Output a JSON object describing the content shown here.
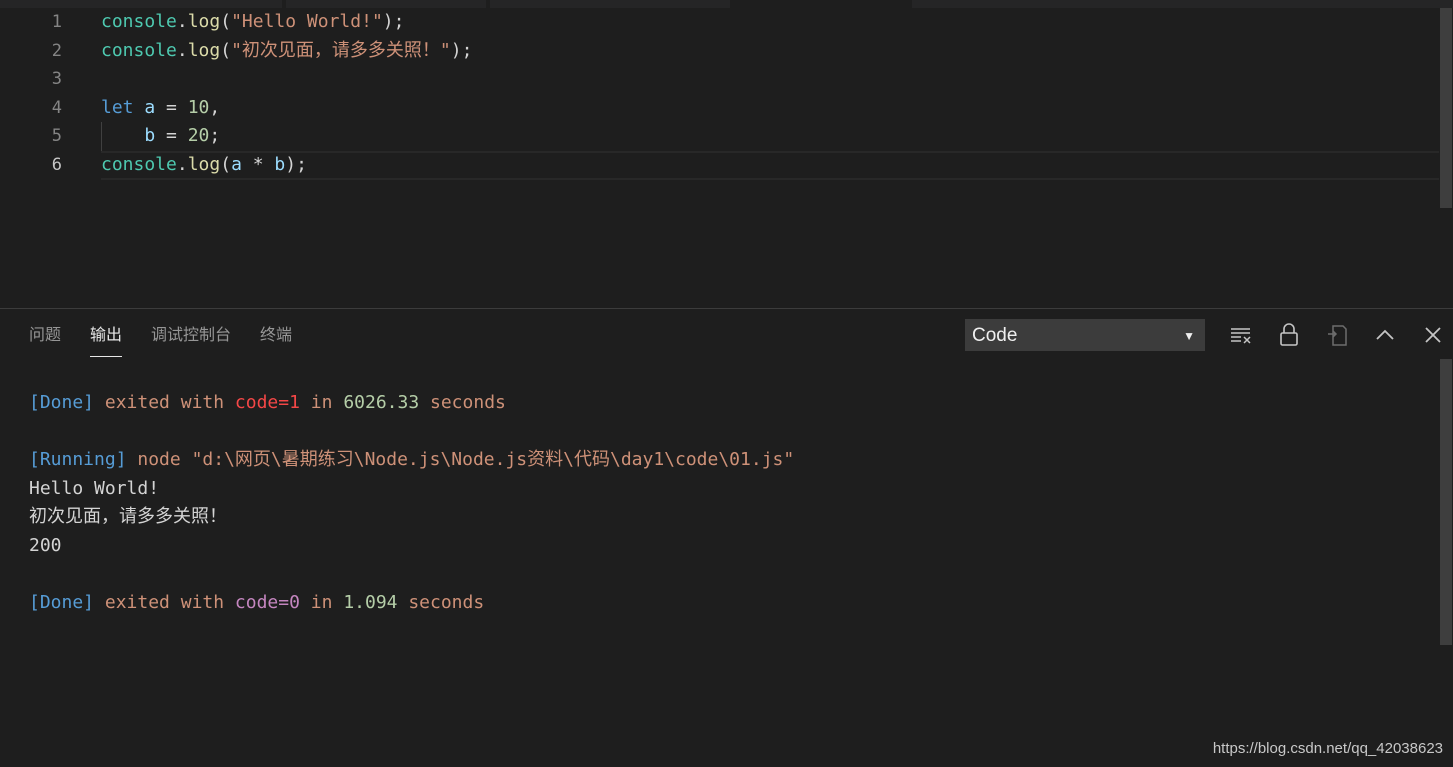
{
  "editor": {
    "line_numbers": [
      "1",
      "2",
      "3",
      "4",
      "5",
      "6"
    ],
    "active_line": "6",
    "lines": [
      {
        "tokens": [
          {
            "t": "console",
            "c": "ident"
          },
          {
            "t": ".",
            "c": "punc"
          },
          {
            "t": "log",
            "c": "fn"
          },
          {
            "t": "(",
            "c": "punc"
          },
          {
            "t": "\"Hello World!\"",
            "c": "str"
          },
          {
            "t": ");",
            "c": "punc"
          }
        ]
      },
      {
        "tokens": [
          {
            "t": "console",
            "c": "ident"
          },
          {
            "t": ".",
            "c": "punc"
          },
          {
            "t": "log",
            "c": "fn"
          },
          {
            "t": "(",
            "c": "punc"
          },
          {
            "t": "\"初次见面，请多多关照！\"",
            "c": "str"
          },
          {
            "t": ");",
            "c": "punc"
          }
        ]
      },
      {
        "tokens": []
      },
      {
        "tokens": [
          {
            "t": "let",
            "c": "kw"
          },
          {
            "t": " ",
            "c": "punc"
          },
          {
            "t": "a",
            "c": "var"
          },
          {
            "t": " = ",
            "c": "punc"
          },
          {
            "t": "10",
            "c": "num"
          },
          {
            "t": ",",
            "c": "punc"
          }
        ]
      },
      {
        "tokens": [
          {
            "t": "    ",
            "c": "punc"
          },
          {
            "t": "b",
            "c": "var"
          },
          {
            "t": " = ",
            "c": "punc"
          },
          {
            "t": "20",
            "c": "num"
          },
          {
            "t": ";",
            "c": "punc"
          }
        ]
      },
      {
        "tokens": [
          {
            "t": "console",
            "c": "ident"
          },
          {
            "t": ".",
            "c": "punc"
          },
          {
            "t": "log",
            "c": "fn"
          },
          {
            "t": "(",
            "c": "punc"
          },
          {
            "t": "a",
            "c": "var"
          },
          {
            "t": " * ",
            "c": "punc"
          },
          {
            "t": "b",
            "c": "var"
          },
          {
            "t": ");",
            "c": "punc"
          }
        ]
      }
    ]
  },
  "panel": {
    "tabs": [
      {
        "label": "问题",
        "active": false
      },
      {
        "label": "输出",
        "active": true
      },
      {
        "label": "调试控制台",
        "active": false
      },
      {
        "label": "终端",
        "active": false
      }
    ],
    "channel_select": "Code",
    "icons": [
      "clear-output-icon",
      "lock-scroll-icon",
      "open-log-icon",
      "maximize-panel-icon",
      "close-panel-icon"
    ]
  },
  "output": {
    "lines": [
      {
        "tokens": [
          {
            "t": "[Done]",
            "c": "bracket"
          },
          {
            "t": " exited with ",
            "c": "text"
          },
          {
            "t": "code=1",
            "c": "code-err"
          },
          {
            "t": " in ",
            "c": "text"
          },
          {
            "t": "6026.33",
            "c": "num"
          },
          {
            "t": " seconds",
            "c": "text"
          }
        ]
      },
      {
        "tokens": []
      },
      {
        "tokens": [
          {
            "t": "[Running]",
            "c": "bracket"
          },
          {
            "t": " node \"d:\\网页\\暑期练习\\Node.js\\Node.js资料\\代码\\day1\\code\\01.js\"",
            "c": "text"
          }
        ]
      },
      {
        "tokens": [
          {
            "t": "Hello World!",
            "c": "plain"
          }
        ]
      },
      {
        "tokens": [
          {
            "t": "初次见面，请多多关照！",
            "c": "plain"
          }
        ]
      },
      {
        "tokens": [
          {
            "t": "200",
            "c": "plain"
          }
        ]
      },
      {
        "tokens": []
      },
      {
        "tokens": [
          {
            "t": "[Done]",
            "c": "bracket"
          },
          {
            "t": " exited with ",
            "c": "text"
          },
          {
            "t": "code=0",
            "c": "code-ok"
          },
          {
            "t": " in ",
            "c": "text"
          },
          {
            "t": "1.094",
            "c": "num"
          },
          {
            "t": " seconds",
            "c": "text"
          }
        ]
      }
    ]
  },
  "watermark": "https://blog.csdn.net/qq_42038623"
}
